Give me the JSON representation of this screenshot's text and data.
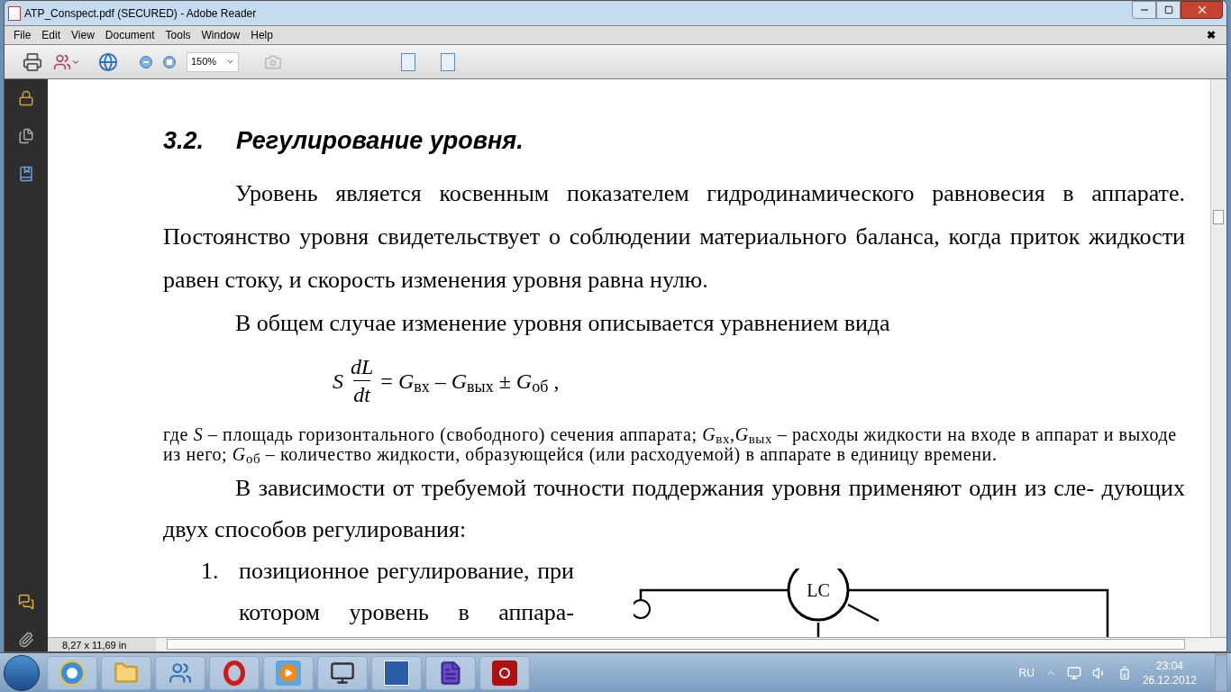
{
  "window": {
    "title": "ATP_Conspect.pdf (SECURED) - Adobe Reader"
  },
  "menu": {
    "items": [
      "File",
      "Edit",
      "View",
      "Document",
      "Tools",
      "Window",
      "Help"
    ],
    "close": "✖"
  },
  "toolbar": {
    "zoom": "150%"
  },
  "document": {
    "heading": {
      "number": "3.2.",
      "title": "Регулирование уровня."
    },
    "paragraphs": [
      "Уровень является косвенным показателем гидродинамического равновесия в аппарате. Постоянство уровня свидетельствует о соблюдении материального баланса, когда приток жидкости равен стоку, и скорость изменения уровня равна нулю.",
      "В общем случае изменение уровня описывается уравнением вида"
    ],
    "formula": {
      "lhs": "S",
      "numerator": "dL",
      "denominator": "dt",
      "rhs": "= *G*$_{вх}$ – *G*$_{вых}$ ± *G*$_{об}$ ,"
    },
    "note": "где *S* – площадь горизонтального (свободного) сечения аппарата; *G*$_{вх}$,*G*$_{вых}$ – расходы жидкости на входе в аппарат и выходе из него; *G*$_{об}$ – количество жидкости, образующейся (или расходуемой) в аппарате в единицу времени.",
    "paragraph_after": "В зависимости от требуемой точности поддержания уровня применяют один из сле- дующих двух способов регулирования:",
    "list": [
      {
        "number": "1.",
        "text": "позиционное регулирование, при котором уровень в аппара-"
      }
    ],
    "diagram": {
      "controller": "LC"
    }
  },
  "status_bar": {
    "page_size": "8,27 x 11,69 in"
  },
  "taskbar": {
    "apps": [
      {
        "kind": "ie"
      },
      {
        "kind": "folder"
      },
      {
        "kind": "user"
      },
      {
        "kind": "opera"
      },
      {
        "kind": "media"
      },
      {
        "kind": "scanner"
      },
      {
        "kind": "word"
      },
      {
        "kind": "editor"
      },
      {
        "kind": "reader"
      }
    ],
    "language": "RU",
    "time": "23:04",
    "date": "26.12.2012"
  }
}
